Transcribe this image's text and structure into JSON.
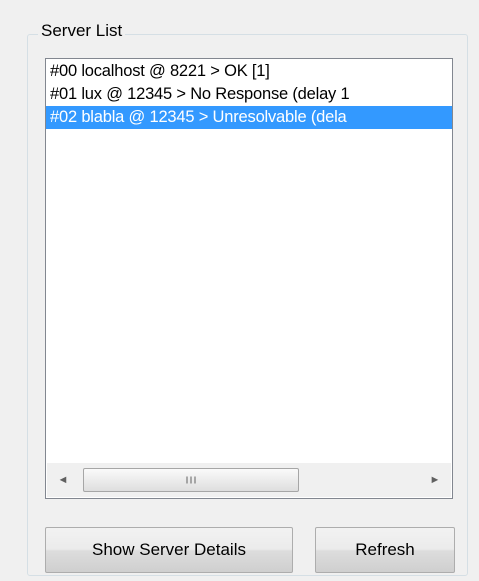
{
  "group": {
    "title": "Server List"
  },
  "server_list": {
    "items": [
      {
        "label": "#00 localhost @ 8221 > OK [1]",
        "selected": false
      },
      {
        "label": "#01 lux @ 12345 > No Response (delay 1",
        "selected": false
      },
      {
        "label": "#02 blabla @ 12345 > Unresolvable (dela",
        "selected": true
      }
    ]
  },
  "scrollbar": {
    "left_arrow": "◄",
    "right_arrow": "►"
  },
  "buttons": {
    "details_label": "Show Server Details",
    "refresh_label": "Refresh"
  },
  "colors": {
    "selection": "#3399ff",
    "window_bg": "#f0f0f0"
  }
}
